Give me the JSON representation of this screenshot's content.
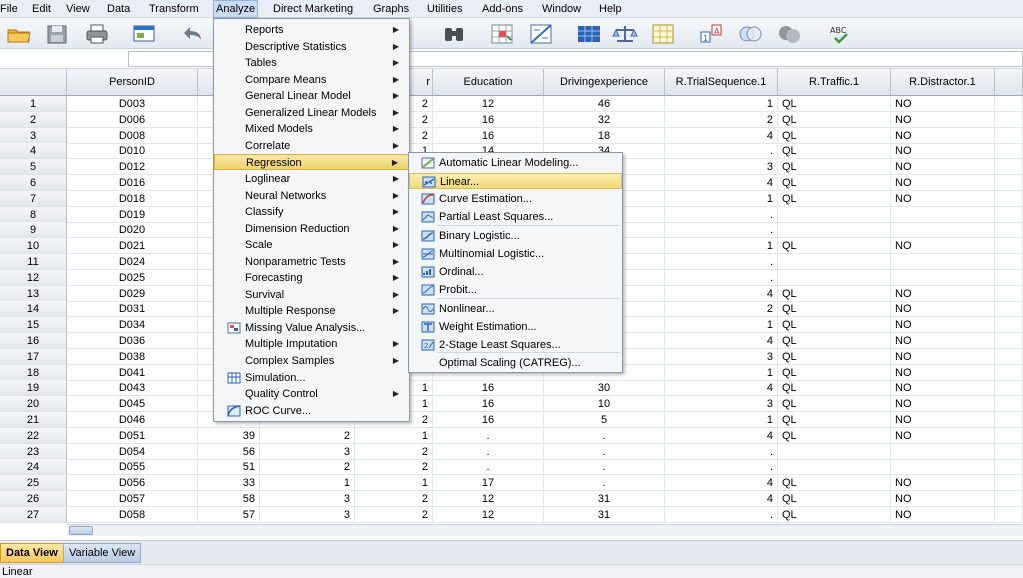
{
  "menubar": [
    "File",
    "Edit",
    "View",
    "Data",
    "Transform",
    "Analyze",
    "Direct Marketing",
    "Graphs",
    "Utilities",
    "Add-ons",
    "Window",
    "Help"
  ],
  "toolbar_icons": [
    "open-folder-icon",
    "save-icon",
    "print-icon",
    "recall-dialog-icon",
    "undo-icon",
    "find-icon",
    "insert-cases-icon",
    "split-file-icon",
    "value-labels-icon",
    "weight-cases-icon",
    "select-cases-icon",
    "use-sets-icon",
    "show-all-variables-icon",
    "spell-check-icon"
  ],
  "columns": [
    {
      "label": "PersonID"
    },
    {
      "label": ""
    },
    {
      "label": ""
    },
    {
      "label": "r"
    },
    {
      "label": "Education"
    },
    {
      "label": "Drivingexperience"
    },
    {
      "label": "R.TrialSequence.1"
    },
    {
      "label": "R.Traffic.1"
    },
    {
      "label": "R.Distractor.1"
    }
  ],
  "rows": [
    {
      "n": "1",
      "id": "D003",
      "age": "",
      "c3": "",
      "c4": "2",
      "edu": "12",
      "drv": "46",
      "seq": "1",
      "traf": "QL",
      "dist": "NO"
    },
    {
      "n": "2",
      "id": "D006",
      "age": "",
      "c3": "",
      "c4": "2",
      "edu": "16",
      "drv": "32",
      "seq": "2",
      "traf": "QL",
      "dist": "NO"
    },
    {
      "n": "3",
      "id": "D008",
      "age": "",
      "c3": "",
      "c4": "2",
      "edu": "16",
      "drv": "18",
      "seq": "4",
      "traf": "QL",
      "dist": "NO"
    },
    {
      "n": "4",
      "id": "D010",
      "age": "",
      "c3": "",
      "c4": "1",
      "edu": "14",
      "drv": "34",
      "seq": ".",
      "traf": "QL",
      "dist": "NO"
    },
    {
      "n": "5",
      "id": "D012",
      "age": "",
      "c3": "",
      "c4": "",
      "edu": "",
      "drv": "",
      "seq": "3",
      "traf": "QL",
      "dist": "NO"
    },
    {
      "n": "6",
      "id": "D016",
      "age": "",
      "c3": "",
      "c4": "",
      "edu": "",
      "drv": "",
      "seq": "4",
      "traf": "QL",
      "dist": "NO"
    },
    {
      "n": "7",
      "id": "D018",
      "age": "",
      "c3": "",
      "c4": "",
      "edu": "",
      "drv": "",
      "seq": "1",
      "traf": "QL",
      "dist": "NO"
    },
    {
      "n": "8",
      "id": "D019",
      "age": "",
      "c3": "",
      "c4": "",
      "edu": "",
      "drv": "",
      "seq": ".",
      "traf": "",
      "dist": ""
    },
    {
      "n": "9",
      "id": "D020",
      "age": "",
      "c3": "",
      "c4": "",
      "edu": "",
      "drv": "",
      "seq": ".",
      "traf": "",
      "dist": ""
    },
    {
      "n": "10",
      "id": "D021",
      "age": "",
      "c3": "",
      "c4": "",
      "edu": "",
      "drv": "",
      "seq": "1",
      "traf": "QL",
      "dist": "NO"
    },
    {
      "n": "11",
      "id": "D024",
      "age": "",
      "c3": "",
      "c4": "",
      "edu": "",
      "drv": "",
      "seq": ".",
      "traf": "",
      "dist": ""
    },
    {
      "n": "12",
      "id": "D025",
      "age": "",
      "c3": "",
      "c4": "",
      "edu": "",
      "drv": "",
      "seq": ".",
      "traf": "",
      "dist": ""
    },
    {
      "n": "13",
      "id": "D029",
      "age": "",
      "c3": "",
      "c4": "",
      "edu": "",
      "drv": "",
      "seq": "4",
      "traf": "QL",
      "dist": "NO"
    },
    {
      "n": "14",
      "id": "D031",
      "age": "",
      "c3": "",
      "c4": "",
      "edu": "",
      "drv": "",
      "seq": "2",
      "traf": "QL",
      "dist": "NO"
    },
    {
      "n": "15",
      "id": "D034",
      "age": "",
      "c3": "",
      "c4": "",
      "edu": "",
      "drv": "",
      "seq": "1",
      "traf": "QL",
      "dist": "NO"
    },
    {
      "n": "16",
      "id": "D036",
      "age": "",
      "c3": "",
      "c4": "",
      "edu": "",
      "drv": "",
      "seq": "4",
      "traf": "QL",
      "dist": "NO"
    },
    {
      "n": "17",
      "id": "D038",
      "age": "",
      "c3": "",
      "c4": "",
      "edu": "",
      "drv": "",
      "seq": "3",
      "traf": "QL",
      "dist": "NO"
    },
    {
      "n": "18",
      "id": "D041",
      "age": "",
      "c3": "",
      "c4": "",
      "edu": "",
      "drv": "",
      "seq": "1",
      "traf": "QL",
      "dist": "NO"
    },
    {
      "n": "19",
      "id": "D043",
      "age": "",
      "c3": "",
      "c4": "1",
      "edu": "16",
      "drv": "30",
      "seq": "4",
      "traf": "QL",
      "dist": "NO"
    },
    {
      "n": "20",
      "id": "D045",
      "age": "",
      "c3": "",
      "c4": "1",
      "edu": "16",
      "drv": "10",
      "seq": "3",
      "traf": "QL",
      "dist": "NO"
    },
    {
      "n": "21",
      "id": "D046",
      "age": "",
      "c3": "",
      "c4": "2",
      "edu": "16",
      "drv": "5",
      "seq": "1",
      "traf": "QL",
      "dist": "NO"
    },
    {
      "n": "22",
      "id": "D051",
      "age": "39",
      "c3": "2",
      "c4": "1",
      "edu": ".",
      "drv": ".",
      "seq": "4",
      "traf": "QL",
      "dist": "NO"
    },
    {
      "n": "23",
      "id": "D054",
      "age": "56",
      "c3": "3",
      "c4": "2",
      "edu": ".",
      "drv": ".",
      "seq": ".",
      "traf": "",
      "dist": ""
    },
    {
      "n": "24",
      "id": "D055",
      "age": "51",
      "c3": "2",
      "c4": "2",
      "edu": ".",
      "drv": ".",
      "seq": ".",
      "traf": "",
      "dist": ""
    },
    {
      "n": "25",
      "id": "D056",
      "age": "33",
      "c3": "1",
      "c4": "1",
      "edu": "17",
      "drv": ".",
      "seq": "4",
      "traf": "QL",
      "dist": "NO"
    },
    {
      "n": "26",
      "id": "D057",
      "age": "58",
      "c3": "3",
      "c4": "2",
      "edu": "12",
      "drv": "31",
      "seq": "4",
      "traf": "QL",
      "dist": "NO"
    },
    {
      "n": "27",
      "id": "D058",
      "age": "57",
      "c3": "3",
      "c4": "2",
      "edu": "12",
      "drv": "31",
      "seq": ".",
      "traf": "QL",
      "dist": "NO"
    }
  ],
  "analyze_menu": [
    {
      "label": "Reports",
      "sub": true,
      "icon": ""
    },
    {
      "label": "Descriptive Statistics",
      "sub": true,
      "icon": ""
    },
    {
      "label": "Tables",
      "sub": true,
      "icon": ""
    },
    {
      "label": "Compare Means",
      "sub": true,
      "icon": ""
    },
    {
      "label": "General Linear Model",
      "sub": true,
      "icon": ""
    },
    {
      "label": "Generalized Linear Models",
      "sub": true,
      "icon": ""
    },
    {
      "label": "Mixed Models",
      "sub": true,
      "icon": ""
    },
    {
      "label": "Correlate",
      "sub": true,
      "icon": ""
    },
    {
      "label": "Regression",
      "sub": true,
      "icon": "",
      "highlight": true
    },
    {
      "label": "Loglinear",
      "sub": true,
      "icon": ""
    },
    {
      "label": "Neural Networks",
      "sub": true,
      "icon": ""
    },
    {
      "label": "Classify",
      "sub": true,
      "icon": ""
    },
    {
      "label": "Dimension Reduction",
      "sub": true,
      "icon": ""
    },
    {
      "label": "Scale",
      "sub": true,
      "icon": ""
    },
    {
      "label": "Nonparametric Tests",
      "sub": true,
      "icon": ""
    },
    {
      "label": "Forecasting",
      "sub": true,
      "icon": ""
    },
    {
      "label": "Survival",
      "sub": true,
      "icon": ""
    },
    {
      "label": "Multiple Response",
      "sub": true,
      "icon": ""
    },
    {
      "label": "Missing Value Analysis...",
      "sub": false,
      "icon": "missing-value-icon"
    },
    {
      "label": "Multiple Imputation",
      "sub": true,
      "icon": ""
    },
    {
      "label": "Complex Samples",
      "sub": true,
      "icon": ""
    },
    {
      "label": "Simulation...",
      "sub": false,
      "icon": "simulation-icon"
    },
    {
      "label": "Quality Control",
      "sub": true,
      "icon": ""
    },
    {
      "label": "ROC Curve...",
      "sub": false,
      "icon": "roc-curve-icon"
    }
  ],
  "regression_menu": [
    {
      "label": "Automatic Linear Modeling...",
      "icon": "automatic-linear-icon"
    },
    {
      "label": "Linear...",
      "icon": "linear-regression-icon",
      "highlight": true
    },
    {
      "label": "Curve Estimation...",
      "icon": "curve-estimation-icon"
    },
    {
      "label": "Partial Least Squares...",
      "icon": "pls-icon"
    },
    {
      "label": "Binary Logistic...",
      "icon": "binary-logistic-icon"
    },
    {
      "label": "Multinomial Logistic...",
      "icon": "multinomial-logistic-icon"
    },
    {
      "label": "Ordinal...",
      "icon": "ordinal-icon"
    },
    {
      "label": "Probit...",
      "icon": "probit-icon"
    },
    {
      "label": "Nonlinear...",
      "icon": "nonlinear-icon"
    },
    {
      "label": "Weight Estimation...",
      "icon": "weight-estimation-icon"
    },
    {
      "label": "2-Stage Least Squares...",
      "icon": "two-stage-least-squares-icon"
    },
    {
      "label": "Optimal Scaling (CATREG)...",
      "icon": ""
    }
  ],
  "tabs": [
    "Data View",
    "Variable View"
  ],
  "status_text": "Linear"
}
